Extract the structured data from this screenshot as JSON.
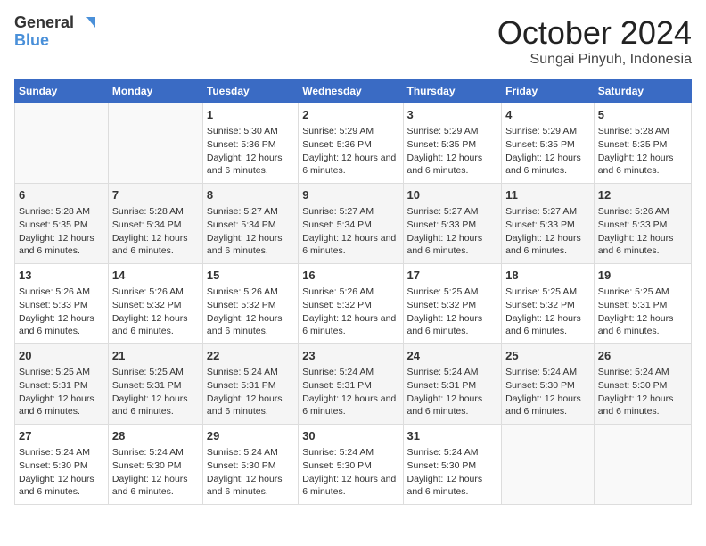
{
  "logo": {
    "line1": "General",
    "line2": "Blue"
  },
  "title": "October 2024",
  "location": "Sungai Pinyuh, Indonesia",
  "headers": [
    "Sunday",
    "Monday",
    "Tuesday",
    "Wednesday",
    "Thursday",
    "Friday",
    "Saturday"
  ],
  "weeks": [
    [
      {
        "day": "",
        "empty": true
      },
      {
        "day": "",
        "empty": true
      },
      {
        "day": "1",
        "sunrise": "Sunrise: 5:30 AM",
        "sunset": "Sunset: 5:36 PM",
        "daylight": "Daylight: 12 hours and 6 minutes."
      },
      {
        "day": "2",
        "sunrise": "Sunrise: 5:29 AM",
        "sunset": "Sunset: 5:36 PM",
        "daylight": "Daylight: 12 hours and 6 minutes."
      },
      {
        "day": "3",
        "sunrise": "Sunrise: 5:29 AM",
        "sunset": "Sunset: 5:35 PM",
        "daylight": "Daylight: 12 hours and 6 minutes."
      },
      {
        "day": "4",
        "sunrise": "Sunrise: 5:29 AM",
        "sunset": "Sunset: 5:35 PM",
        "daylight": "Daylight: 12 hours and 6 minutes."
      },
      {
        "day": "5",
        "sunrise": "Sunrise: 5:28 AM",
        "sunset": "Sunset: 5:35 PM",
        "daylight": "Daylight: 12 hours and 6 minutes."
      }
    ],
    [
      {
        "day": "6",
        "sunrise": "Sunrise: 5:28 AM",
        "sunset": "Sunset: 5:35 PM",
        "daylight": "Daylight: 12 hours and 6 minutes."
      },
      {
        "day": "7",
        "sunrise": "Sunrise: 5:28 AM",
        "sunset": "Sunset: 5:34 PM",
        "daylight": "Daylight: 12 hours and 6 minutes."
      },
      {
        "day": "8",
        "sunrise": "Sunrise: 5:27 AM",
        "sunset": "Sunset: 5:34 PM",
        "daylight": "Daylight: 12 hours and 6 minutes."
      },
      {
        "day": "9",
        "sunrise": "Sunrise: 5:27 AM",
        "sunset": "Sunset: 5:34 PM",
        "daylight": "Daylight: 12 hours and 6 minutes."
      },
      {
        "day": "10",
        "sunrise": "Sunrise: 5:27 AM",
        "sunset": "Sunset: 5:33 PM",
        "daylight": "Daylight: 12 hours and 6 minutes."
      },
      {
        "day": "11",
        "sunrise": "Sunrise: 5:27 AM",
        "sunset": "Sunset: 5:33 PM",
        "daylight": "Daylight: 12 hours and 6 minutes."
      },
      {
        "day": "12",
        "sunrise": "Sunrise: 5:26 AM",
        "sunset": "Sunset: 5:33 PM",
        "daylight": "Daylight: 12 hours and 6 minutes."
      }
    ],
    [
      {
        "day": "13",
        "sunrise": "Sunrise: 5:26 AM",
        "sunset": "Sunset: 5:33 PM",
        "daylight": "Daylight: 12 hours and 6 minutes."
      },
      {
        "day": "14",
        "sunrise": "Sunrise: 5:26 AM",
        "sunset": "Sunset: 5:32 PM",
        "daylight": "Daylight: 12 hours and 6 minutes."
      },
      {
        "day": "15",
        "sunrise": "Sunrise: 5:26 AM",
        "sunset": "Sunset: 5:32 PM",
        "daylight": "Daylight: 12 hours and 6 minutes."
      },
      {
        "day": "16",
        "sunrise": "Sunrise: 5:26 AM",
        "sunset": "Sunset: 5:32 PM",
        "daylight": "Daylight: 12 hours and 6 minutes."
      },
      {
        "day": "17",
        "sunrise": "Sunrise: 5:25 AM",
        "sunset": "Sunset: 5:32 PM",
        "daylight": "Daylight: 12 hours and 6 minutes."
      },
      {
        "day": "18",
        "sunrise": "Sunrise: 5:25 AM",
        "sunset": "Sunset: 5:32 PM",
        "daylight": "Daylight: 12 hours and 6 minutes."
      },
      {
        "day": "19",
        "sunrise": "Sunrise: 5:25 AM",
        "sunset": "Sunset: 5:31 PM",
        "daylight": "Daylight: 12 hours and 6 minutes."
      }
    ],
    [
      {
        "day": "20",
        "sunrise": "Sunrise: 5:25 AM",
        "sunset": "Sunset: 5:31 PM",
        "daylight": "Daylight: 12 hours and 6 minutes."
      },
      {
        "day": "21",
        "sunrise": "Sunrise: 5:25 AM",
        "sunset": "Sunset: 5:31 PM",
        "daylight": "Daylight: 12 hours and 6 minutes."
      },
      {
        "day": "22",
        "sunrise": "Sunrise: 5:24 AM",
        "sunset": "Sunset: 5:31 PM",
        "daylight": "Daylight: 12 hours and 6 minutes."
      },
      {
        "day": "23",
        "sunrise": "Sunrise: 5:24 AM",
        "sunset": "Sunset: 5:31 PM",
        "daylight": "Daylight: 12 hours and 6 minutes."
      },
      {
        "day": "24",
        "sunrise": "Sunrise: 5:24 AM",
        "sunset": "Sunset: 5:31 PM",
        "daylight": "Daylight: 12 hours and 6 minutes."
      },
      {
        "day": "25",
        "sunrise": "Sunrise: 5:24 AM",
        "sunset": "Sunset: 5:30 PM",
        "daylight": "Daylight: 12 hours and 6 minutes."
      },
      {
        "day": "26",
        "sunrise": "Sunrise: 5:24 AM",
        "sunset": "Sunset: 5:30 PM",
        "daylight": "Daylight: 12 hours and 6 minutes."
      }
    ],
    [
      {
        "day": "27",
        "sunrise": "Sunrise: 5:24 AM",
        "sunset": "Sunset: 5:30 PM",
        "daylight": "Daylight: 12 hours and 6 minutes."
      },
      {
        "day": "28",
        "sunrise": "Sunrise: 5:24 AM",
        "sunset": "Sunset: 5:30 PM",
        "daylight": "Daylight: 12 hours and 6 minutes."
      },
      {
        "day": "29",
        "sunrise": "Sunrise: 5:24 AM",
        "sunset": "Sunset: 5:30 PM",
        "daylight": "Daylight: 12 hours and 6 minutes."
      },
      {
        "day": "30",
        "sunrise": "Sunrise: 5:24 AM",
        "sunset": "Sunset: 5:30 PM",
        "daylight": "Daylight: 12 hours and 6 minutes."
      },
      {
        "day": "31",
        "sunrise": "Sunrise: 5:24 AM",
        "sunset": "Sunset: 5:30 PM",
        "daylight": "Daylight: 12 hours and 6 minutes."
      },
      {
        "day": "",
        "empty": true
      },
      {
        "day": "",
        "empty": true
      }
    ]
  ]
}
